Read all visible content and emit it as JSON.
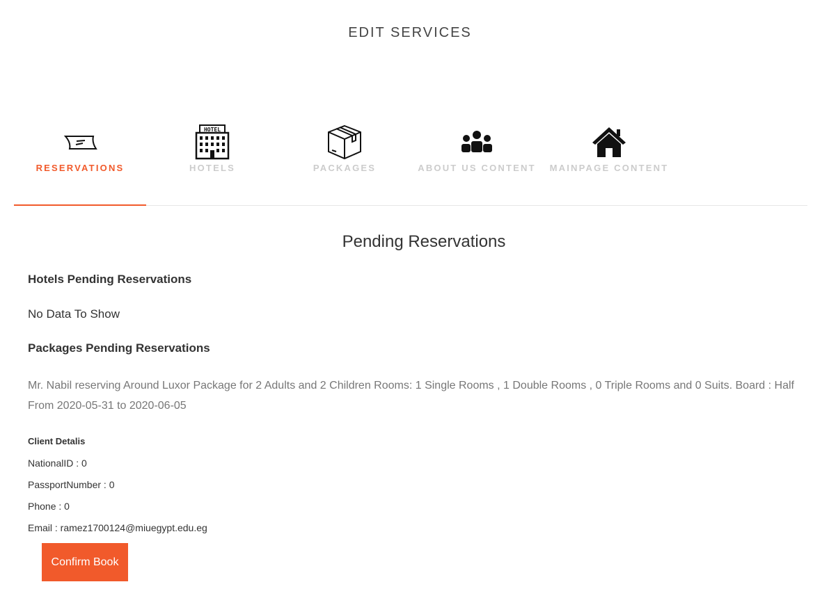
{
  "header": {
    "title": "EDIT SERVICES"
  },
  "tabs": [
    {
      "label": "RESERVATIONS",
      "icon": "ticket-icon",
      "active": true
    },
    {
      "label": "HOTELS",
      "icon": "hotel-icon",
      "active": false
    },
    {
      "label": "PACKAGES",
      "icon": "package-box-icon",
      "active": false
    },
    {
      "label": "ABOUT US CONTENT",
      "icon": "people-group-icon",
      "active": false
    },
    {
      "label": "MAINPAGE CONTENT",
      "icon": "house-icon",
      "active": false
    }
  ],
  "colors": {
    "accent": "#f15a2b",
    "inactive_tab": "#cccccc"
  },
  "main": {
    "title": "Pending Reservations",
    "hotels_heading": "Hotels Pending Reservations",
    "hotels_empty": "No Data To Show",
    "packages_heading": "Packages Pending Reservations",
    "reservation_line1": "Mr. Nabil reserving Around Luxor Package for 2 Adults and 2 Children Rooms: 1 Single Rooms , 1 Double Rooms , 0 Triple Rooms and 0 Suits. Board : Half",
    "reservation_line2": "From 2020-05-31 to 2020-06-05",
    "client_details_heading": "Client Detalis",
    "national_id": "NationalID : 0",
    "passport_number": "PassportNumber : 0",
    "phone": "Phone : 0",
    "email": "Email : ramez1700124@miuegypt.edu.eg",
    "confirm_button": "Confirm Book"
  }
}
